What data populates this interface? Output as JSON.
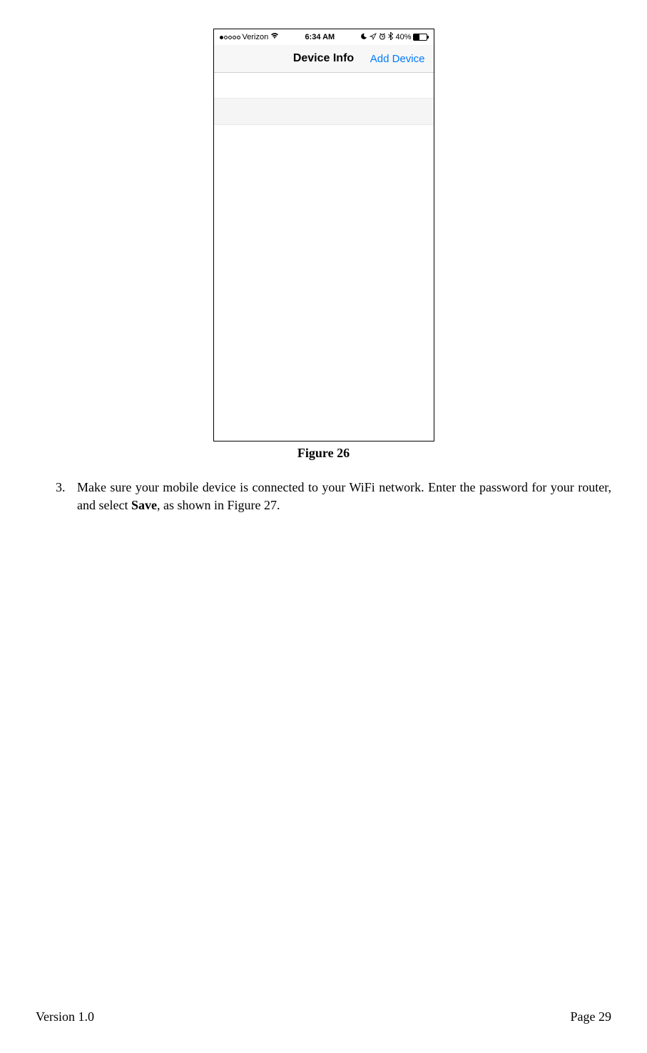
{
  "phone": {
    "status_bar": {
      "carrier": "Verizon",
      "time": "6:34 AM",
      "battery_percent": "40%"
    },
    "nav": {
      "title": "Device Info",
      "right_button": "Add Device"
    }
  },
  "figure_caption": "Figure 26",
  "instruction": {
    "number": "3.",
    "text_before_bold": "Make sure your mobile device is connected to your WiFi network.   Enter the password for your router, and select ",
    "bold_word": "Save",
    "text_after_bold": ", as shown in Figure 27."
  },
  "footer": {
    "version": "Version 1.0",
    "page": "Page 29"
  }
}
